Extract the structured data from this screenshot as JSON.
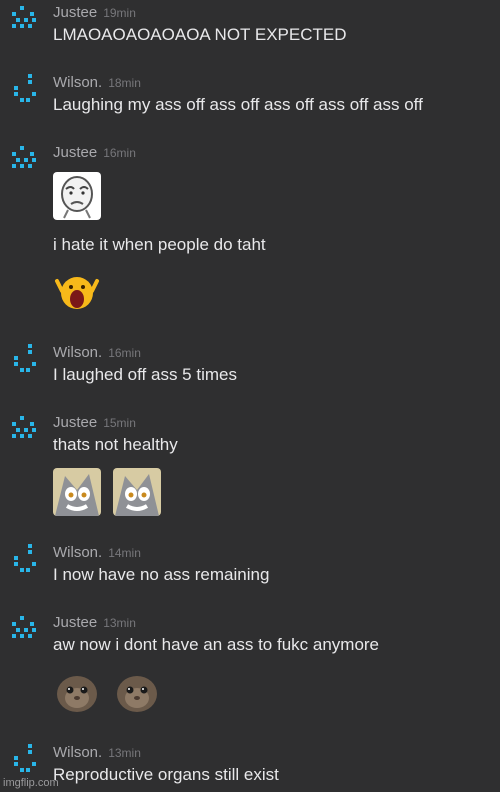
{
  "messages": [
    {
      "author": "Justee",
      "time": "19min",
      "text": "LMAOAOAOAOAOA NOT EXPECTED"
    },
    {
      "author": "Wilson.",
      "time": "18min",
      "text": "Laughing my ass off ass off ass off ass off ass off"
    },
    {
      "author": "Justee",
      "time": "16min",
      "text": ""
    },
    {
      "author": "Justee",
      "time": "16min",
      "text": "i hate it when people do taht"
    },
    {
      "author": "Wilson.",
      "time": "16min",
      "text": "I laughed off ass 5 times"
    },
    {
      "author": "Justee",
      "time": "15min",
      "text": "thats not healthy"
    },
    {
      "author": "Wilson.",
      "time": "14min",
      "text": "I now have no ass remaining"
    },
    {
      "author": "Justee",
      "time": "13min",
      "text": "aw now i dont have an ass to fukc anymore"
    },
    {
      "author": "Wilson.",
      "time": "13min",
      "text": "Reproductive organs still exist"
    }
  ],
  "footer": "imgflip.com",
  "colors": {
    "background": "#2f2f30",
    "avatar": "#29b6e8",
    "name": "#a9a9ad",
    "text": "#e8e8ea"
  }
}
